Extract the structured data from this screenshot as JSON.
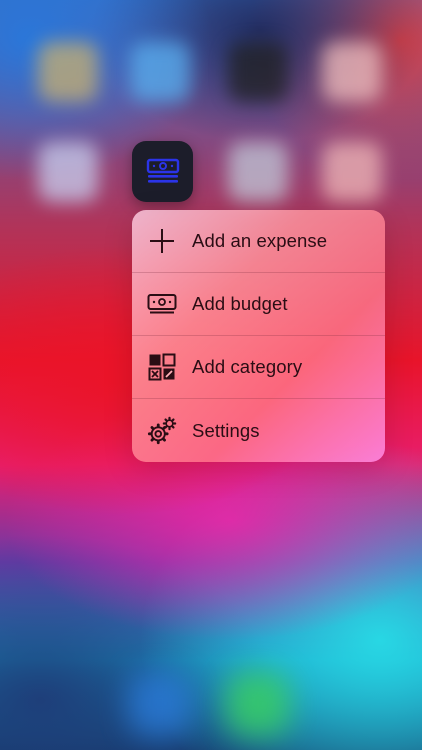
{
  "app": {
    "icon_name": "money-stack-icon",
    "accent_color": "#2b34e8",
    "icon_background": "#1c1d2a"
  },
  "quick_actions": {
    "items": [
      {
        "label": "Add an expense",
        "icon": "plus-icon"
      },
      {
        "label": "Add budget",
        "icon": "banknote-icon"
      },
      {
        "label": "Add category",
        "icon": "category-grid-icon"
      },
      {
        "label": "Settings",
        "icon": "gears-icon"
      }
    ]
  }
}
